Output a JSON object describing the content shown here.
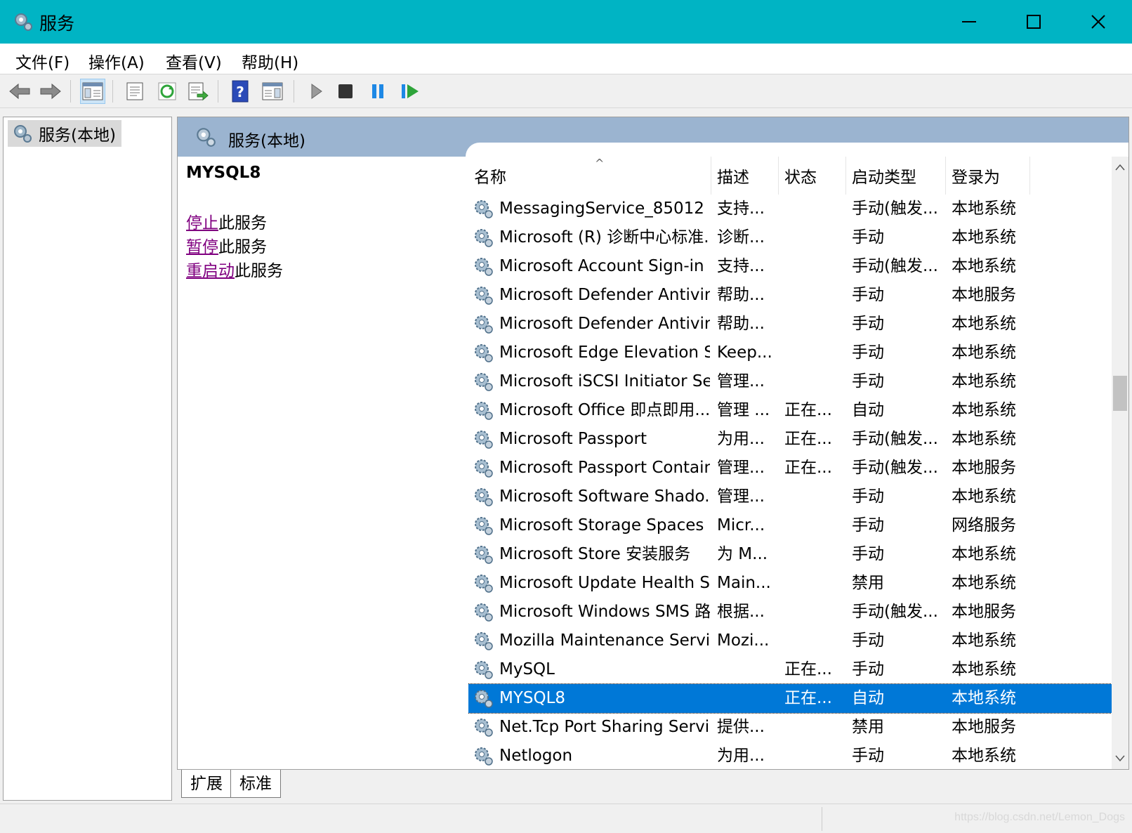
{
  "window": {
    "title": "服务",
    "controls": {
      "minimize": "minimize",
      "maximize": "maximize",
      "close": "✕"
    }
  },
  "menu": [
    "文件(F)",
    "操作(A)",
    "查看(V)",
    "帮助(H)"
  ],
  "toolbar": {
    "icons": [
      "back-arrow-icon",
      "forward-arrow-icon",
      "show-hide-console-tree-icon",
      "properties-icon",
      "refresh-icon",
      "export-list-icon",
      "help-icon",
      "action-pane-icon",
      "start-icon",
      "stop-icon",
      "pause-icon",
      "restart-icon"
    ]
  },
  "tree": {
    "item": "服务(本地)"
  },
  "pane": {
    "title": "服务(本地)"
  },
  "details": {
    "service_name": "MYSQL8",
    "actions": [
      {
        "link": "停止",
        "suffix": "此服务"
      },
      {
        "link": "暂停",
        "suffix": "此服务"
      },
      {
        "link": "重启动",
        "suffix": "此服务"
      }
    ]
  },
  "table": {
    "sort_indicator": "^",
    "headers": [
      "名称",
      "描述",
      "状态",
      "启动类型",
      "登录为"
    ],
    "rows": [
      {
        "name": "MessagingService_85012",
        "desc": "支持...",
        "status": "",
        "startup": "手动(触发...",
        "logon": "本地系统"
      },
      {
        "name": "Microsoft (R) 诊断中心标准...",
        "desc": "诊断...",
        "status": "",
        "startup": "手动",
        "logon": "本地系统"
      },
      {
        "name": "Microsoft Account Sign-in ...",
        "desc": "支持...",
        "status": "",
        "startup": "手动(触发...",
        "logon": "本地系统"
      },
      {
        "name": "Microsoft Defender Antivir...",
        "desc": "帮助...",
        "status": "",
        "startup": "手动",
        "logon": "本地服务"
      },
      {
        "name": "Microsoft Defender Antivir...",
        "desc": "帮助...",
        "status": "",
        "startup": "手动",
        "logon": "本地系统"
      },
      {
        "name": "Microsoft Edge Elevation S...",
        "desc": "Keep...",
        "status": "",
        "startup": "手动",
        "logon": "本地系统"
      },
      {
        "name": "Microsoft iSCSI Initiator Ser...",
        "desc": "管理...",
        "status": "",
        "startup": "手动",
        "logon": "本地系统"
      },
      {
        "name": "Microsoft Office 即点即用...",
        "desc": "管理 ...",
        "status": "正在...",
        "startup": "自动",
        "logon": "本地系统"
      },
      {
        "name": "Microsoft Passport",
        "desc": "为用...",
        "status": "正在...",
        "startup": "手动(触发...",
        "logon": "本地系统"
      },
      {
        "name": "Microsoft Passport Container",
        "desc": "管理...",
        "status": "正在...",
        "startup": "手动(触发...",
        "logon": "本地服务"
      },
      {
        "name": "Microsoft Software Shado...",
        "desc": "管理...",
        "status": "",
        "startup": "手动",
        "logon": "本地系统"
      },
      {
        "name": "Microsoft Storage Spaces S...",
        "desc": "Micr...",
        "status": "",
        "startup": "手动",
        "logon": "网络服务"
      },
      {
        "name": "Microsoft Store 安装服务",
        "desc": "为 M...",
        "status": "",
        "startup": "手动",
        "logon": "本地系统"
      },
      {
        "name": "Microsoft Update Health S...",
        "desc": "Main...",
        "status": "",
        "startup": "禁用",
        "logon": "本地系统"
      },
      {
        "name": "Microsoft Windows SMS 路...",
        "desc": "根据...",
        "status": "",
        "startup": "手动(触发...",
        "logon": "本地服务"
      },
      {
        "name": "Mozilla Maintenance Service",
        "desc": "Mozi...",
        "status": "",
        "startup": "手动",
        "logon": "本地系统"
      },
      {
        "name": "MySQL",
        "desc": "",
        "status": "正在...",
        "startup": "手动",
        "logon": "本地系统"
      },
      {
        "name": "MYSQL8",
        "desc": "",
        "status": "正在...",
        "startup": "自动",
        "logon": "本地系统",
        "selected": true
      },
      {
        "name": "Net.Tcp Port Sharing Service",
        "desc": "提供...",
        "status": "",
        "startup": "禁用",
        "logon": "本地服务"
      },
      {
        "name": "Netlogon",
        "desc": "为用...",
        "status": "",
        "startup": "手动",
        "logon": "本地系统"
      }
    ]
  },
  "tabs": [
    "扩展",
    "标准"
  ],
  "status": {
    "watermark": "https://blog.csdn.net/Lemon_Dogs"
  },
  "colors": {
    "titlebar": "#00b4c4",
    "selection": "#0078d7",
    "pane_header": "#9bb4d0",
    "link": "#800080"
  }
}
